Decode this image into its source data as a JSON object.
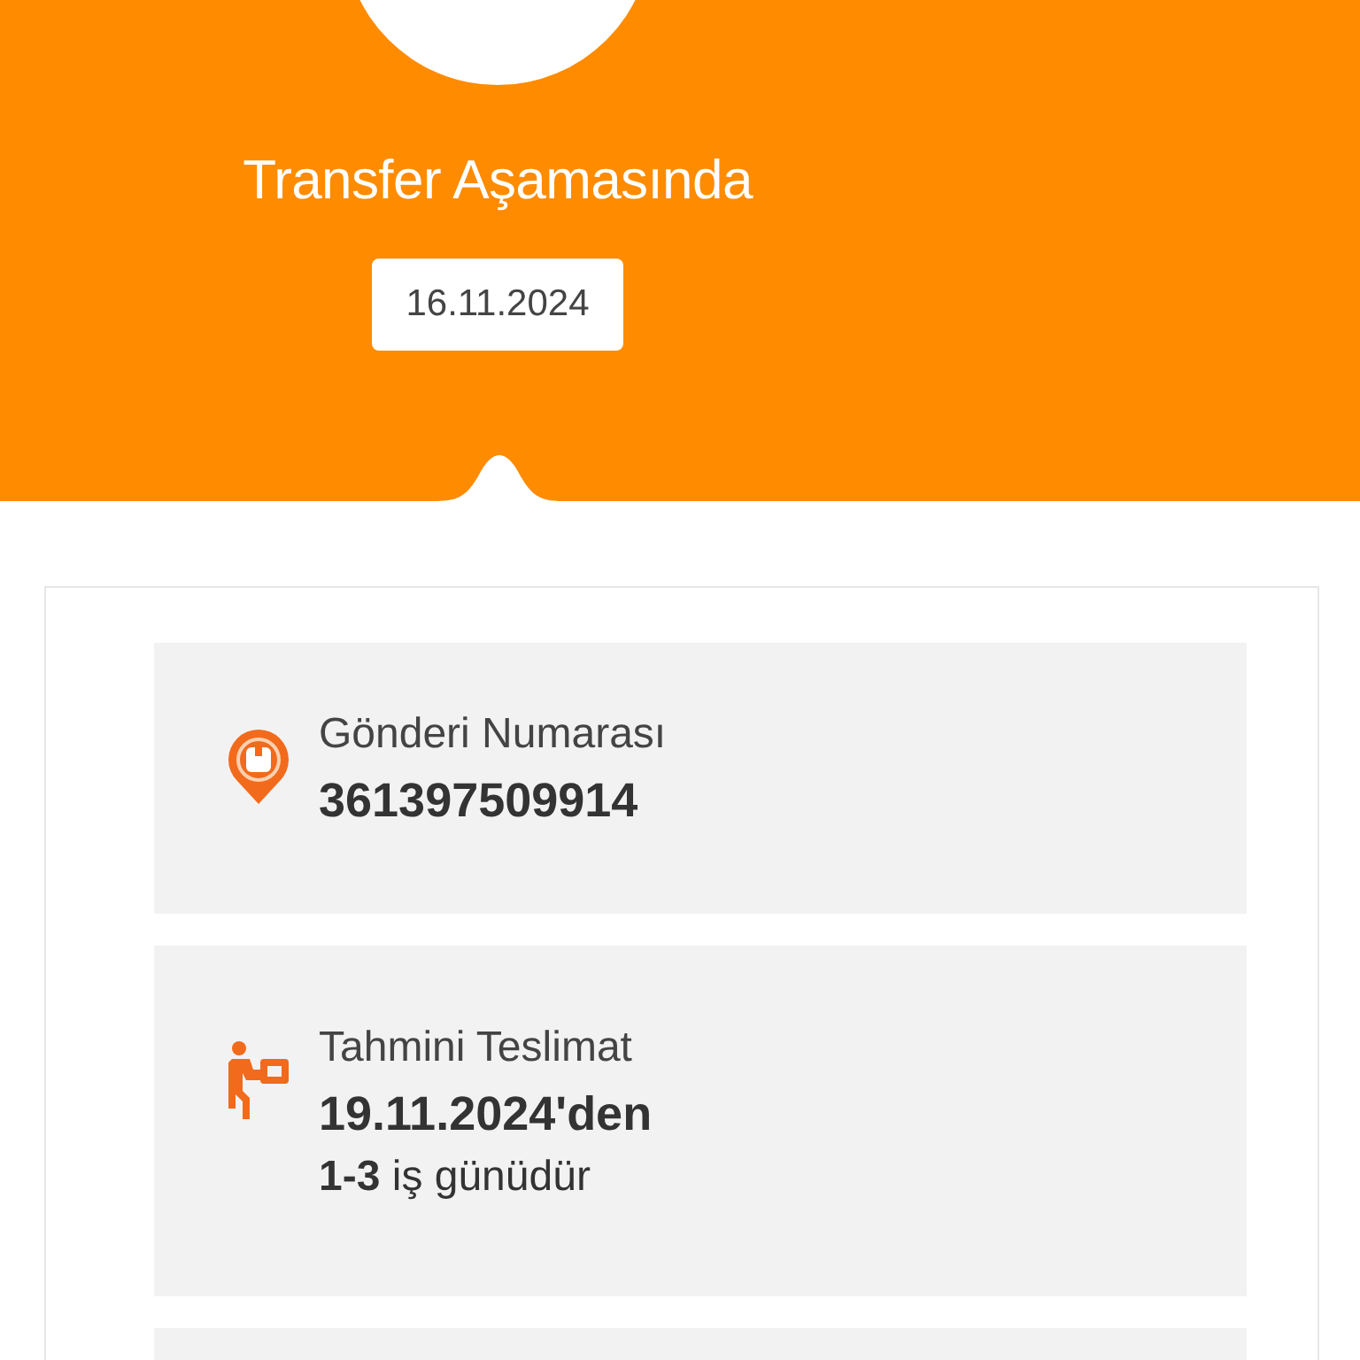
{
  "header": {
    "status": "Transfer Aşamasında",
    "date": "16.11.2024"
  },
  "cards": [
    {
      "kind": "shipment",
      "label": "Gönderi Numarası",
      "value": "361397509914"
    },
    {
      "kind": "delivery",
      "label": "Tahmini Teslimat",
      "value": "19.11.2024'den",
      "detail": "**1-3** iş günüdür"
    }
  ]
}
